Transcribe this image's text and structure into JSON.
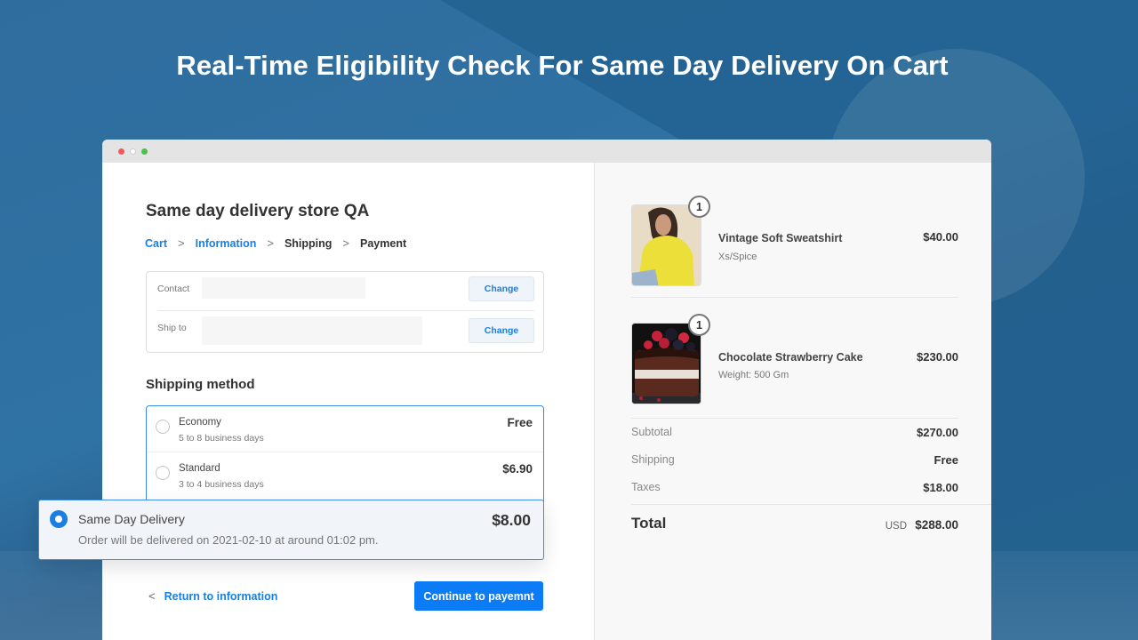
{
  "headline": "Real-Time Eligibility Check For Same Day Delivery On Cart",
  "window": {
    "store_title": "Same day delivery store QA",
    "breadcrumb": [
      {
        "label": "Cart",
        "state": "link"
      },
      {
        "label": "Information",
        "state": "link"
      },
      {
        "label": "Shipping",
        "state": "current"
      },
      {
        "label": "Payment",
        "state": "upcoming"
      }
    ],
    "breadcrumb_separator": ">",
    "info": {
      "contact_label": "Contact",
      "ship_to_label": "Ship to",
      "change_label": "Change"
    },
    "shipping_method_title": "Shipping method",
    "shipping_methods": [
      {
        "name": "Economy",
        "description": "5 to 8 business days",
        "price": "Free",
        "selected": false
      },
      {
        "name": "Standard",
        "description": "3 to 4 business days",
        "price": "$6.90",
        "selected": false
      }
    ],
    "same_day": {
      "name": "Same Day Delivery",
      "description": "Order will be delivered on 2021-02-10 at around 01:02 pm.",
      "price": "$8.00",
      "selected": true
    },
    "return_link": "Return to information",
    "continue_button": "Continue to payemnt"
  },
  "summary": {
    "items": [
      {
        "name": "Vintage Soft Sweatshirt",
        "variant": "Xs/Spice",
        "price": "$40.00",
        "quantity": "1",
        "image": "yellow-sweatshirt-photo"
      },
      {
        "name": "Chocolate Strawberry Cake",
        "variant": "Weight: 500 Gm",
        "price": "$230.00",
        "quantity": "1",
        "image": "chocolate-cake-photo"
      }
    ],
    "subtotal_label": "Subtotal",
    "subtotal": "$270.00",
    "shipping_label": "Shipping",
    "shipping": "Free",
    "taxes_label": "Taxes",
    "taxes": "$18.00",
    "total_label": "Total",
    "currency": "USD",
    "total": "$288.00"
  },
  "colors": {
    "accent": "#1a7fe0",
    "button": "#0b7cf5",
    "background": "#2f6d9e"
  }
}
